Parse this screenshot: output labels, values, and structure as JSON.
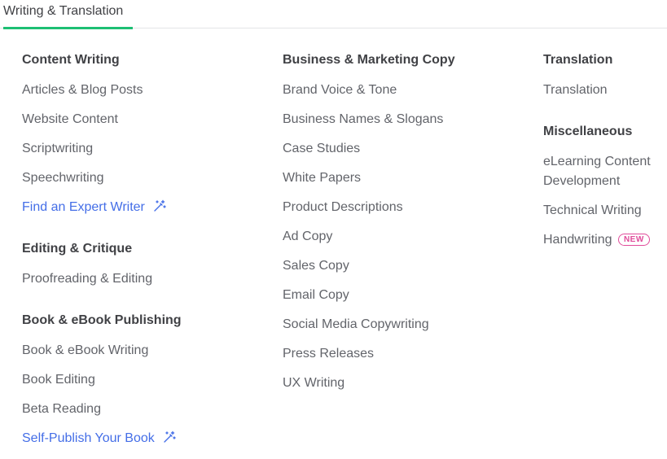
{
  "tab": {
    "label": "Writing & Translation",
    "accent": "#1dbf73"
  },
  "columns": [
    {
      "groups": [
        {
          "title": "Content Writing",
          "items": [
            "Articles & Blog Posts",
            "Website Content",
            "Scriptwriting",
            "Speechwriting"
          ],
          "link": "Find an Expert Writer"
        },
        {
          "title": "Editing & Critique",
          "items": [
            "Proofreading & Editing"
          ]
        },
        {
          "title": "Book & eBook Publishing",
          "items": [
            "Book & eBook Writing",
            "Book Editing",
            "Beta Reading"
          ],
          "link": "Self-Publish Your Book"
        }
      ]
    },
    {
      "groups": [
        {
          "title": "Business & Marketing Copy",
          "items": [
            "Brand Voice & Tone",
            "Business Names & Slogans",
            "Case Studies",
            "White Papers",
            "Product Descriptions",
            "Ad Copy",
            "Sales Copy",
            "Email Copy",
            "Social Media Copywriting",
            "Press Releases",
            "UX Writing"
          ]
        }
      ]
    },
    {
      "groups": [
        {
          "title": "Translation",
          "items": [
            "Translation"
          ]
        },
        {
          "title": "Miscellaneous",
          "items": [
            "eLearning Content Development",
            "Technical Writing",
            "Handwriting"
          ],
          "badge": "NEW"
        }
      ]
    }
  ],
  "colors": {
    "heading": "#404145",
    "item": "#62646a",
    "link": "#446ee7",
    "badge": "#e04b9a"
  },
  "icons": {
    "expert_link_icon": "magic-wand-icon"
  }
}
